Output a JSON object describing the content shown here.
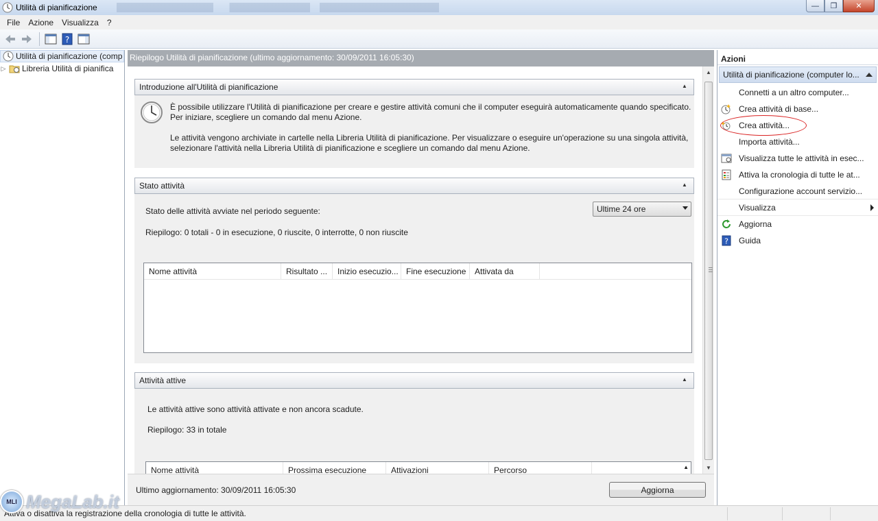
{
  "window": {
    "title": "Utilità di pianificazione",
    "buttons": {
      "minimize": "—",
      "maximize": "❐",
      "close": "✕"
    }
  },
  "menu": [
    "File",
    "Azione",
    "Visualizza",
    "?"
  ],
  "toolbar": {
    "icons": [
      "back-arrow-icon",
      "forward-arrow-icon",
      "show-hide-console-tree-icon",
      "help-icon",
      "show-hide-action-pane-icon"
    ]
  },
  "tree": {
    "root": "Utilità di pianificazione (comp",
    "child": "Libreria Utilità di pianifica"
  },
  "center": {
    "header": "Riepilogo Utilità di pianificazione (ultimo aggiornamento: 30/09/2011 16:05:30)",
    "intro": {
      "title": "Introduzione all'Utilità di pianificazione",
      "p1": "È possibile utilizzare l'Utilità di pianificazione per creare e gestire attività comuni che il computer eseguirà automaticamente quando specificato. Per iniziare, scegliere un comando dal menu Azione.",
      "p2": "Le attività vengono archiviate in cartelle nella Libreria Utilità di pianificazione. Per visualizzare o eseguire un'operazione su una singola attività, selezionare l'attività nella Libreria Utilità di pianificazione e scegliere un comando dal menu Azione."
    },
    "status": {
      "title": "Stato attività",
      "period_label": "Stato delle attività avviate nel periodo seguente:",
      "period_value": "Ultime 24 ore",
      "summary": "Riepilogo: 0 totali - 0 in esecuzione, 0 riuscite, 0 interrotte, 0 non riuscite",
      "columns": [
        "Nome attività",
        "Risultato ...",
        "Inizio esecuzio...",
        "Fine esecuzione",
        "Attivata da"
      ]
    },
    "active": {
      "title": "Attività attive",
      "description": "Le attività attive sono attività attivate e non ancora scadute.",
      "summary": "Riepilogo: 33 in totale",
      "columns": [
        "Nome attività",
        "Prossima esecuzione",
        "Attivazioni",
        "Percorso"
      ]
    },
    "footer": {
      "last_update": "Ultimo aggiornamento: 30/09/2011 16:05:30",
      "refresh_button": "Aggiorna"
    }
  },
  "actions": {
    "title": "Azioni",
    "group": "Utilità di pianificazione (computer lo...",
    "items": [
      {
        "label": "Connetti a un altro computer...",
        "icon": ""
      },
      {
        "label": "Crea attività di base...",
        "icon": "create-basic-task-icon"
      },
      {
        "label": "Crea attività...",
        "icon": "create-task-icon"
      },
      {
        "label": "Importa attività...",
        "icon": ""
      },
      {
        "label": "Visualizza tutte le attività in esec...",
        "icon": "running-tasks-icon"
      },
      {
        "label": "Attiva la cronologia di tutte le at...",
        "icon": "history-icon"
      },
      {
        "label": "Configurazione account servizio...",
        "icon": ""
      },
      {
        "label": "Visualizza",
        "icon": ""
      },
      {
        "label": "Aggiorna",
        "icon": "refresh-icon"
      },
      {
        "label": "Guida",
        "icon": "help-icon"
      }
    ]
  },
  "statusbar": {
    "text": "Attiva o disattiva la registrazione della cronologia di tutte le attività."
  },
  "watermark": {
    "badge": "MLI",
    "text": "MegaLab.it"
  },
  "colors": {
    "center_header_bg": "#a6abb1",
    "annotation_ellipse": "#d92121"
  }
}
